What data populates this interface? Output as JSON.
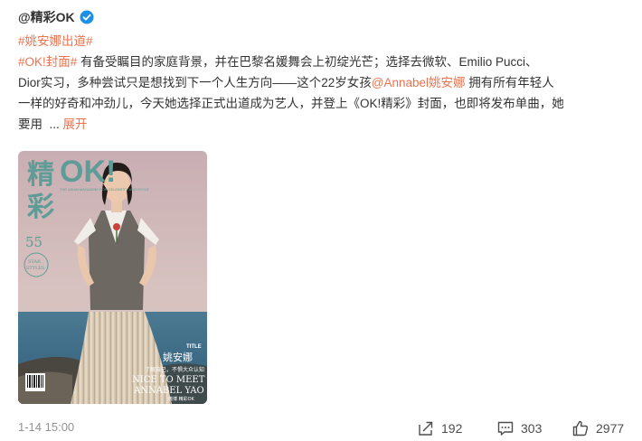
{
  "post": {
    "author": "@精彩OK",
    "topic": "#姚安娜出道#",
    "lines": [
      {
        "hashtag": "#OK!封面#",
        "text": " 有备受瞩目的家庭背景，并在巴黎名媛舞会上初绽光芒；选择去微软、Emilio Pucci、"
      },
      {
        "text": "Dior实习，多种尝试只是想找到下一个人生方向——这个22岁女孩",
        "mention": "@Annabel姚安娜",
        "text_after": " 拥有所有年轻人"
      },
      {
        "text": "一样的好奇和冲劲儿，今天她选择正式出道成为艺人，并登上《OK!精彩》封面，也即将发布单曲，她"
      },
      {
        "text": "要用  ... ",
        "expand": "展开"
      }
    ]
  },
  "cover": {
    "masthead_cn_1": "精",
    "masthead_cn_2": "彩",
    "masthead_logo": "OK!",
    "issue_number": "55",
    "badge_line1": "STAR",
    "badge_line2": "STYLES",
    "tagline": "THE ASIAN MAGAZINE FOR CELEBRITY AND STYLE",
    "headline_1": "NICE TO MEET",
    "headline_2": "ANNABEL YAO",
    "name_cn": "姚安娜",
    "sub_cn": "了解自己，不惧大众认知",
    "label": "TITLE",
    "watermark": "微博 精彩OK"
  },
  "footer": {
    "timestamp": "1-14 15:00",
    "repost_count": "192",
    "comment_count": "303",
    "like_count": "2977"
  },
  "colors": {
    "link": "#eb7350",
    "verified": "#1d90e6",
    "meta": "#939393"
  },
  "icons": {
    "verified": "verified-badge-icon",
    "repost": "repost-icon",
    "comment": "comment-icon",
    "like": "like-icon"
  }
}
